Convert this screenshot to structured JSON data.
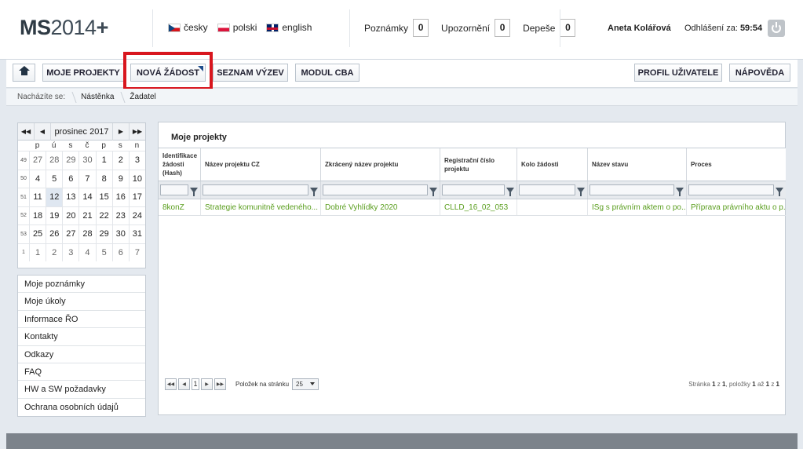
{
  "header": {
    "logo_bold": "MS",
    "logo_year": "2014",
    "logo_plus": "+",
    "languages": [
      {
        "label": "česky",
        "flag": "cz-flag-icon"
      },
      {
        "label": "polski",
        "flag": "pl-flag-icon"
      },
      {
        "label": "english",
        "flag": "gb-flag-icon"
      }
    ],
    "counters": [
      {
        "label": "Poznámky",
        "count": "0"
      },
      {
        "label": "Upozornění",
        "count": "0"
      },
      {
        "label": "Depeše",
        "count": "0"
      }
    ],
    "user_name": "Aneta Kolářová",
    "logout_label": "Odhlášení za:",
    "logout_time": "59:54"
  },
  "nav": {
    "home_icon": "home-icon",
    "items": [
      "MOJE PROJEKTY",
      "NOVÁ ŽÁDOST",
      "SEZNAM VÝZEV",
      "MODUL CBA"
    ],
    "right_items": [
      "PROFIL UŽIVATELE",
      "NÁPOVĚDA"
    ],
    "highlight_color": "#d8161e"
  },
  "breadcrumb": {
    "prefix": "Nacházíte se:",
    "items": [
      "Nástěnka",
      "Žadatel"
    ]
  },
  "calendar": {
    "month": "prosinec 2017",
    "weekdays": [
      "p",
      "ú",
      "s",
      "č",
      "p",
      "s",
      "n"
    ],
    "weeks": [
      {
        "wk": "49",
        "days": [
          "27",
          "28",
          "29",
          "30",
          "1",
          "2",
          "3"
        ]
      },
      {
        "wk": "50",
        "days": [
          "4",
          "5",
          "6",
          "7",
          "8",
          "9",
          "10"
        ]
      },
      {
        "wk": "51",
        "days": [
          "11",
          "12",
          "13",
          "14",
          "15",
          "16",
          "17"
        ]
      },
      {
        "wk": "52",
        "days": [
          "18",
          "19",
          "20",
          "21",
          "22",
          "23",
          "24"
        ]
      },
      {
        "wk": "53",
        "days": [
          "25",
          "26",
          "27",
          "28",
          "29",
          "30",
          "31"
        ]
      },
      {
        "wk": "1",
        "days": [
          "1",
          "2",
          "3",
          "4",
          "5",
          "6",
          "7"
        ]
      }
    ]
  },
  "side_menu": [
    "Moje poznámky",
    "Moje úkoly",
    "Informace ŘO",
    "Kontakty",
    "Odkazy",
    "FAQ",
    "HW a SW požadavky",
    "Ochrana osobních údajů"
  ],
  "projects": {
    "title": "Moje projekty",
    "columns": [
      "Identifikace žádosti (Hash)",
      "Název projektu CZ",
      "Zkrácený název projektu",
      "Registrační číslo projektu",
      "Kolo žádosti",
      "Název stavu",
      "Proces"
    ],
    "rows": [
      [
        "8konZ",
        "Strategie komunitně vedeného...",
        "Dobré Vyhlídky 2020",
        "CLLD_16_02_053",
        "",
        "ISg s právním aktem o po...",
        "Příprava právního aktu o p..."
      ]
    ],
    "row_text_color": "#5a9e1e",
    "pager": {
      "current_page": "1",
      "per_page_label": "Položek na stránku",
      "per_page": "25",
      "info_prefix": "Stránka",
      "info_page": "1",
      "info_of": "z",
      "info_pages": "1",
      "info_items": ", položky",
      "info_from": "1",
      "info_to_word": "až",
      "info_to": "1",
      "info_of2": "z",
      "info_total": "1"
    }
  }
}
